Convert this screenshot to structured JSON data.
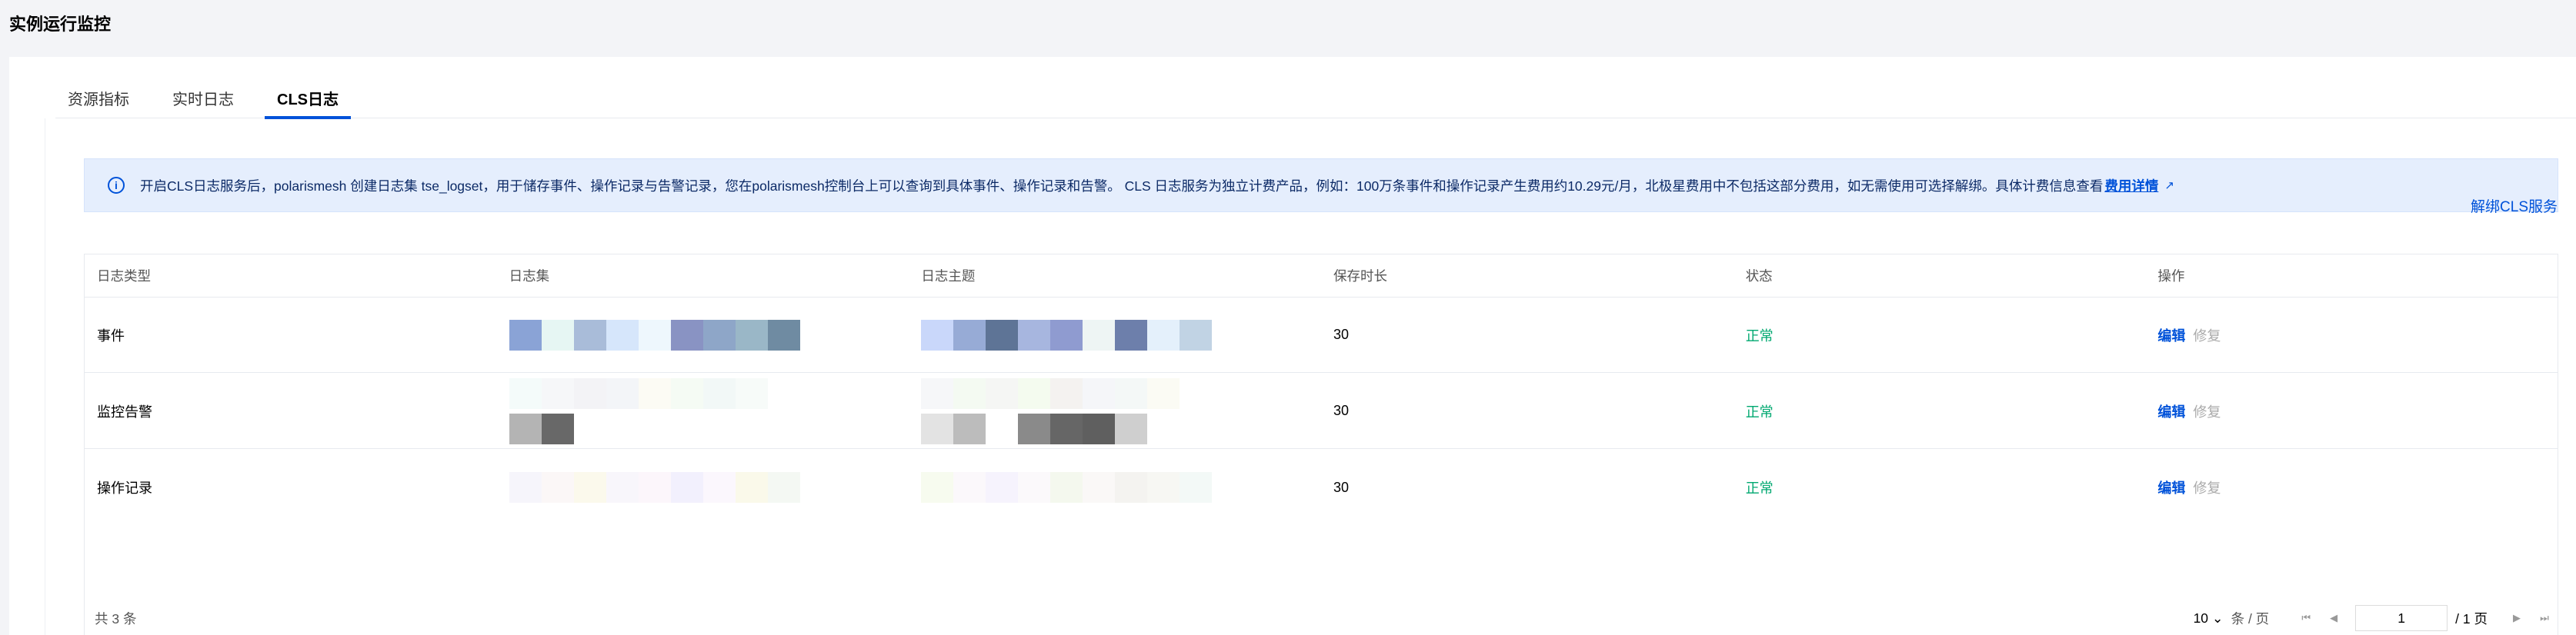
{
  "page": {
    "title": "实例运行监控"
  },
  "tabs": [
    {
      "label": "资源指标",
      "active": false
    },
    {
      "label": "实时日志",
      "active": false
    },
    {
      "label": "CLS日志",
      "active": true
    }
  ],
  "notice": {
    "text": "开启CLS日志服务后，polarismesh 创建日志集 tse_logset，用于储存事件、操作记录与告警记录，您在polarismesh控制台上可以查询到具体事件、操作记录和告警。 CLS 日志服务为独立计费产品，例如：100万条事件和操作记录产生费用约10.29元/月，北极星费用中不包括这部分费用，如无需使用可选择解绑。具体计费信息查看",
    "link_label": "费用详情"
  },
  "unbind_label": "解绑CLS服务",
  "table": {
    "headers": [
      "日志类型",
      "日志集",
      "日志主题",
      "保存时长",
      "状态",
      "操作"
    ],
    "rows": [
      {
        "type": "事件",
        "retention": "30",
        "status": "正常",
        "edit": "编辑",
        "repair": "修复"
      },
      {
        "type": "监控告警",
        "retention": "30",
        "status": "正常",
        "edit": "编辑",
        "repair": "修复"
      },
      {
        "type": "操作记录",
        "retention": "30",
        "status": "正常",
        "edit": "编辑",
        "repair": "修复"
      }
    ]
  },
  "footer": {
    "total": "共 3 条",
    "page_size": "10",
    "page_size_unit": "条 / 页",
    "current_page": "1",
    "total_pages": "/ 1 页"
  },
  "colors": {
    "primary": "#0052d9",
    "success": "#00a870",
    "notice_bg": "#e5eefd"
  }
}
